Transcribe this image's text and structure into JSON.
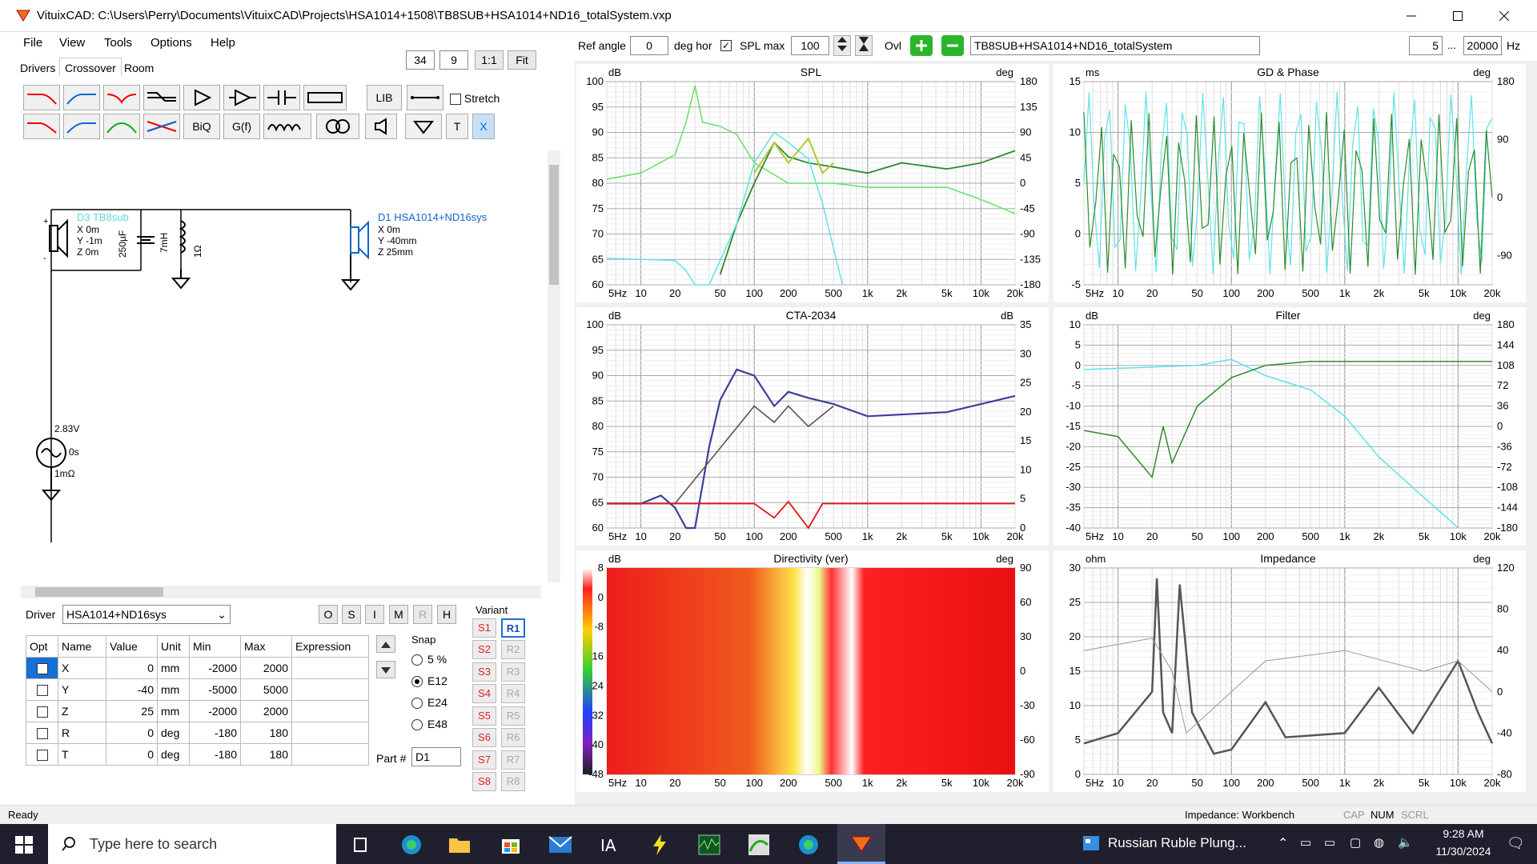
{
  "window": {
    "title": "VituixCAD: C:\\Users\\Perry\\Documents\\VituixCAD\\Projects\\HSA1014+1508\\TB8SUB+HSA1014+ND16_totalSystem.vxp"
  },
  "menu": [
    "File",
    "View",
    "Tools",
    "Options",
    "Help"
  ],
  "tabs": [
    "Drivers",
    "Crossover",
    "Room"
  ],
  "zoom": {
    "v1": "34",
    "v2": "9",
    "one_to_one": "1:1",
    "fit": "Fit"
  },
  "toolbar": {
    "lib": "LIB",
    "stretch": "Stretch",
    "biq": "BiQ",
    "gf": "G(f)",
    "t": "T",
    "x": "X"
  },
  "topbar": {
    "ref_angle_label": "Ref angle",
    "ref_angle": "0",
    "deg_hor": "deg hor",
    "spl_max_label": "SPL max",
    "spl_max": "100",
    "ovl": "Ovl",
    "project": "TB8SUB+HSA1014+ND16_totalSystem",
    "fmin": "5",
    "dots": "...",
    "fmax": "20000",
    "hz": "Hz"
  },
  "schematic": {
    "d3": {
      "name": "D3 TB8sub",
      "x": "X 0m",
      "y": "Y -1m",
      "z": "Z 0m"
    },
    "cap": "250µF",
    "ind": "7mH",
    "res": "1Ω",
    "d1": {
      "name": "D1 HSA1014+ND16sys",
      "x": "X 0m",
      "y": "Y -40mm",
      "z": "Z 25mm"
    },
    "src": {
      "v": "2.83V",
      "t": "0s",
      "r": "1mΩ"
    }
  },
  "driver": {
    "label": "Driver",
    "selected": "HSA1014+ND16sys",
    "btns": [
      "O",
      "S",
      "I",
      "M",
      "R",
      "H"
    ]
  },
  "params": {
    "headers": [
      "Opt",
      "Name",
      "Value",
      "Unit",
      "Min",
      "Max",
      "Expression"
    ],
    "rows": [
      [
        "X",
        "0",
        "mm",
        "-2000",
        "2000"
      ],
      [
        "Y",
        "-40",
        "mm",
        "-5000",
        "5000"
      ],
      [
        "Z",
        "25",
        "mm",
        "-2000",
        "2000"
      ],
      [
        "R",
        "0",
        "deg",
        "-180",
        "180"
      ],
      [
        "T",
        "0",
        "deg",
        "-180",
        "180"
      ]
    ]
  },
  "snap": {
    "label": "Snap",
    "opts": [
      "5 %",
      "E12",
      "E24",
      "E48"
    ],
    "selected": 1
  },
  "part": {
    "label": "Part #",
    "value": "D1"
  },
  "variant": {
    "label": "Variant",
    "s": [
      "S1",
      "S2",
      "S3",
      "S4",
      "S5",
      "S6",
      "S7",
      "S8"
    ],
    "r": [
      "R1",
      "R2",
      "R3",
      "R4",
      "R5",
      "R6",
      "R7",
      "R8"
    ]
  },
  "freq_ticks": [
    "5Hz",
    "10",
    "20",
    "50",
    "100",
    "200",
    "500",
    "1k",
    "2k",
    "5k",
    "10k",
    "20k"
  ],
  "graphs": {
    "spl": {
      "title": "SPL",
      "lunit": "dB",
      "runit": "deg",
      "left": [
        "100",
        "95",
        "90",
        "85",
        "80",
        "75",
        "70",
        "65",
        "60"
      ],
      "right": [
        "180",
        "135",
        "90",
        "45",
        "0",
        "-45",
        "-90",
        "-135",
        "-180"
      ]
    },
    "gd": {
      "title": "GD & Phase",
      "lunit": "ms",
      "runit": "deg",
      "left": [
        "15",
        "10",
        "5",
        "0",
        "-5"
      ],
      "right": [
        "180",
        "",
        "90",
        "",
        "0",
        "",
        "-90",
        ""
      ]
    },
    "cta": {
      "title": "CTA-2034",
      "lunit": "dB",
      "runit": "dB",
      "left": [
        "100",
        "95",
        "90",
        "85",
        "80",
        "75",
        "70",
        "65",
        "60"
      ],
      "right": [
        "35",
        "30",
        "25",
        "20",
        "15",
        "10",
        "5",
        "0"
      ]
    },
    "filter": {
      "title": "Filter",
      "lunit": "dB",
      "runit": "deg",
      "left": [
        "10",
        "5",
        "0",
        "-5",
        "-10",
        "-15",
        "-20",
        "-25",
        "-30",
        "-35",
        "-40"
      ],
      "right": [
        "180",
        "144",
        "108",
        "72",
        "36",
        "0",
        "-36",
        "-72",
        "-108",
        "-144",
        "-180"
      ]
    },
    "dir": {
      "title": "Directivity (ver)",
      "lunit": "dB",
      "runit": "deg",
      "left": [
        "8",
        "0",
        "-8",
        "-16",
        "-24",
        "-32",
        "-40",
        "-48"
      ],
      "right": [
        "90",
        "60",
        "30",
        "0",
        "-30",
        "-60",
        "-90"
      ]
    },
    "imp": {
      "title": "Impedance",
      "lunit": "ohm",
      "runit": "deg",
      "left": [
        "30",
        "25",
        "20",
        "15",
        "10",
        "5",
        "0"
      ],
      "right": [
        "120",
        "80",
        "40",
        "0",
        "-40",
        "-80"
      ]
    }
  },
  "status": {
    "left": "Ready",
    "right": "Impedance: Workbench",
    "cap": "CAP",
    "num": "NUM",
    "scrl": "SCRL"
  },
  "taskbar": {
    "search": "Type here to search",
    "news": "Russian Ruble Plung...",
    "time": "9:28 AM",
    "date": "11/30/2024"
  },
  "colors": {
    "green_dark": "#2e8b2e",
    "green_light": "#66e066",
    "olive": "#b5c832",
    "cyan": "#5fe3e8",
    "navy": "#3b3f9c",
    "red": "#e21414",
    "gray": "#555555"
  }
}
